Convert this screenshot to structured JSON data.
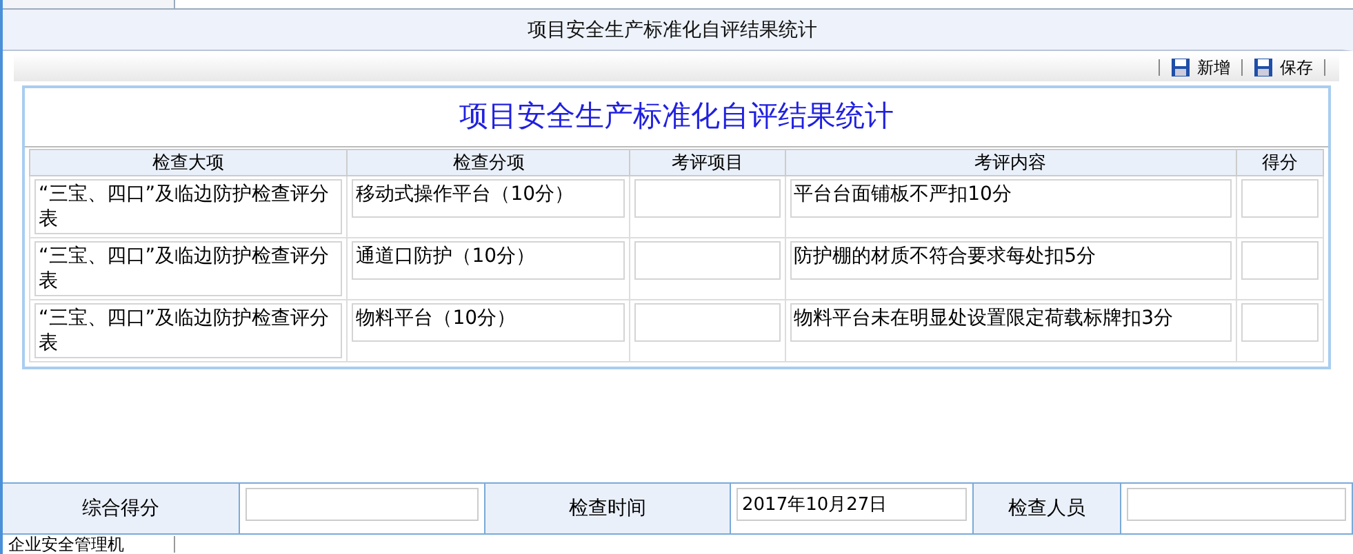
{
  "title_bar": {
    "title": "项目安全生产标准化自评结果统计"
  },
  "toolbar": {
    "buttons": [
      {
        "label": "新增"
      },
      {
        "label": "保存"
      }
    ]
  },
  "form": {
    "heading": "项目安全生产标准化自评结果统计",
    "columns": [
      "检查大项",
      "检查分项",
      "考评项目",
      "考评内容",
      "得分"
    ],
    "rows": [
      {
        "category": "“三宝、四口”及临边防护检查评分表",
        "subitem": "移动式操作平台（10分）",
        "content": "平台台面铺板不严扣10分"
      },
      {
        "category": "“三宝、四口”及临边防护检查评分表",
        "subitem": "通道口防护（10分）",
        "content": "防护棚的材质不符合要求每处扣5分"
      },
      {
        "category": "“三宝、四口”及临边防护检查评分表",
        "subitem": "物料平台（10分）",
        "content": "物料平台未在明显处设置限定荷载标牌扣3分"
      }
    ]
  },
  "summary": {
    "fields": [
      {
        "label": "综合得分"
      },
      {
        "label": "检查时间",
        "value": "2017年10月27日"
      },
      {
        "label": "检查人员"
      }
    ]
  },
  "next_row": {
    "label": "企业安全管理机"
  }
}
